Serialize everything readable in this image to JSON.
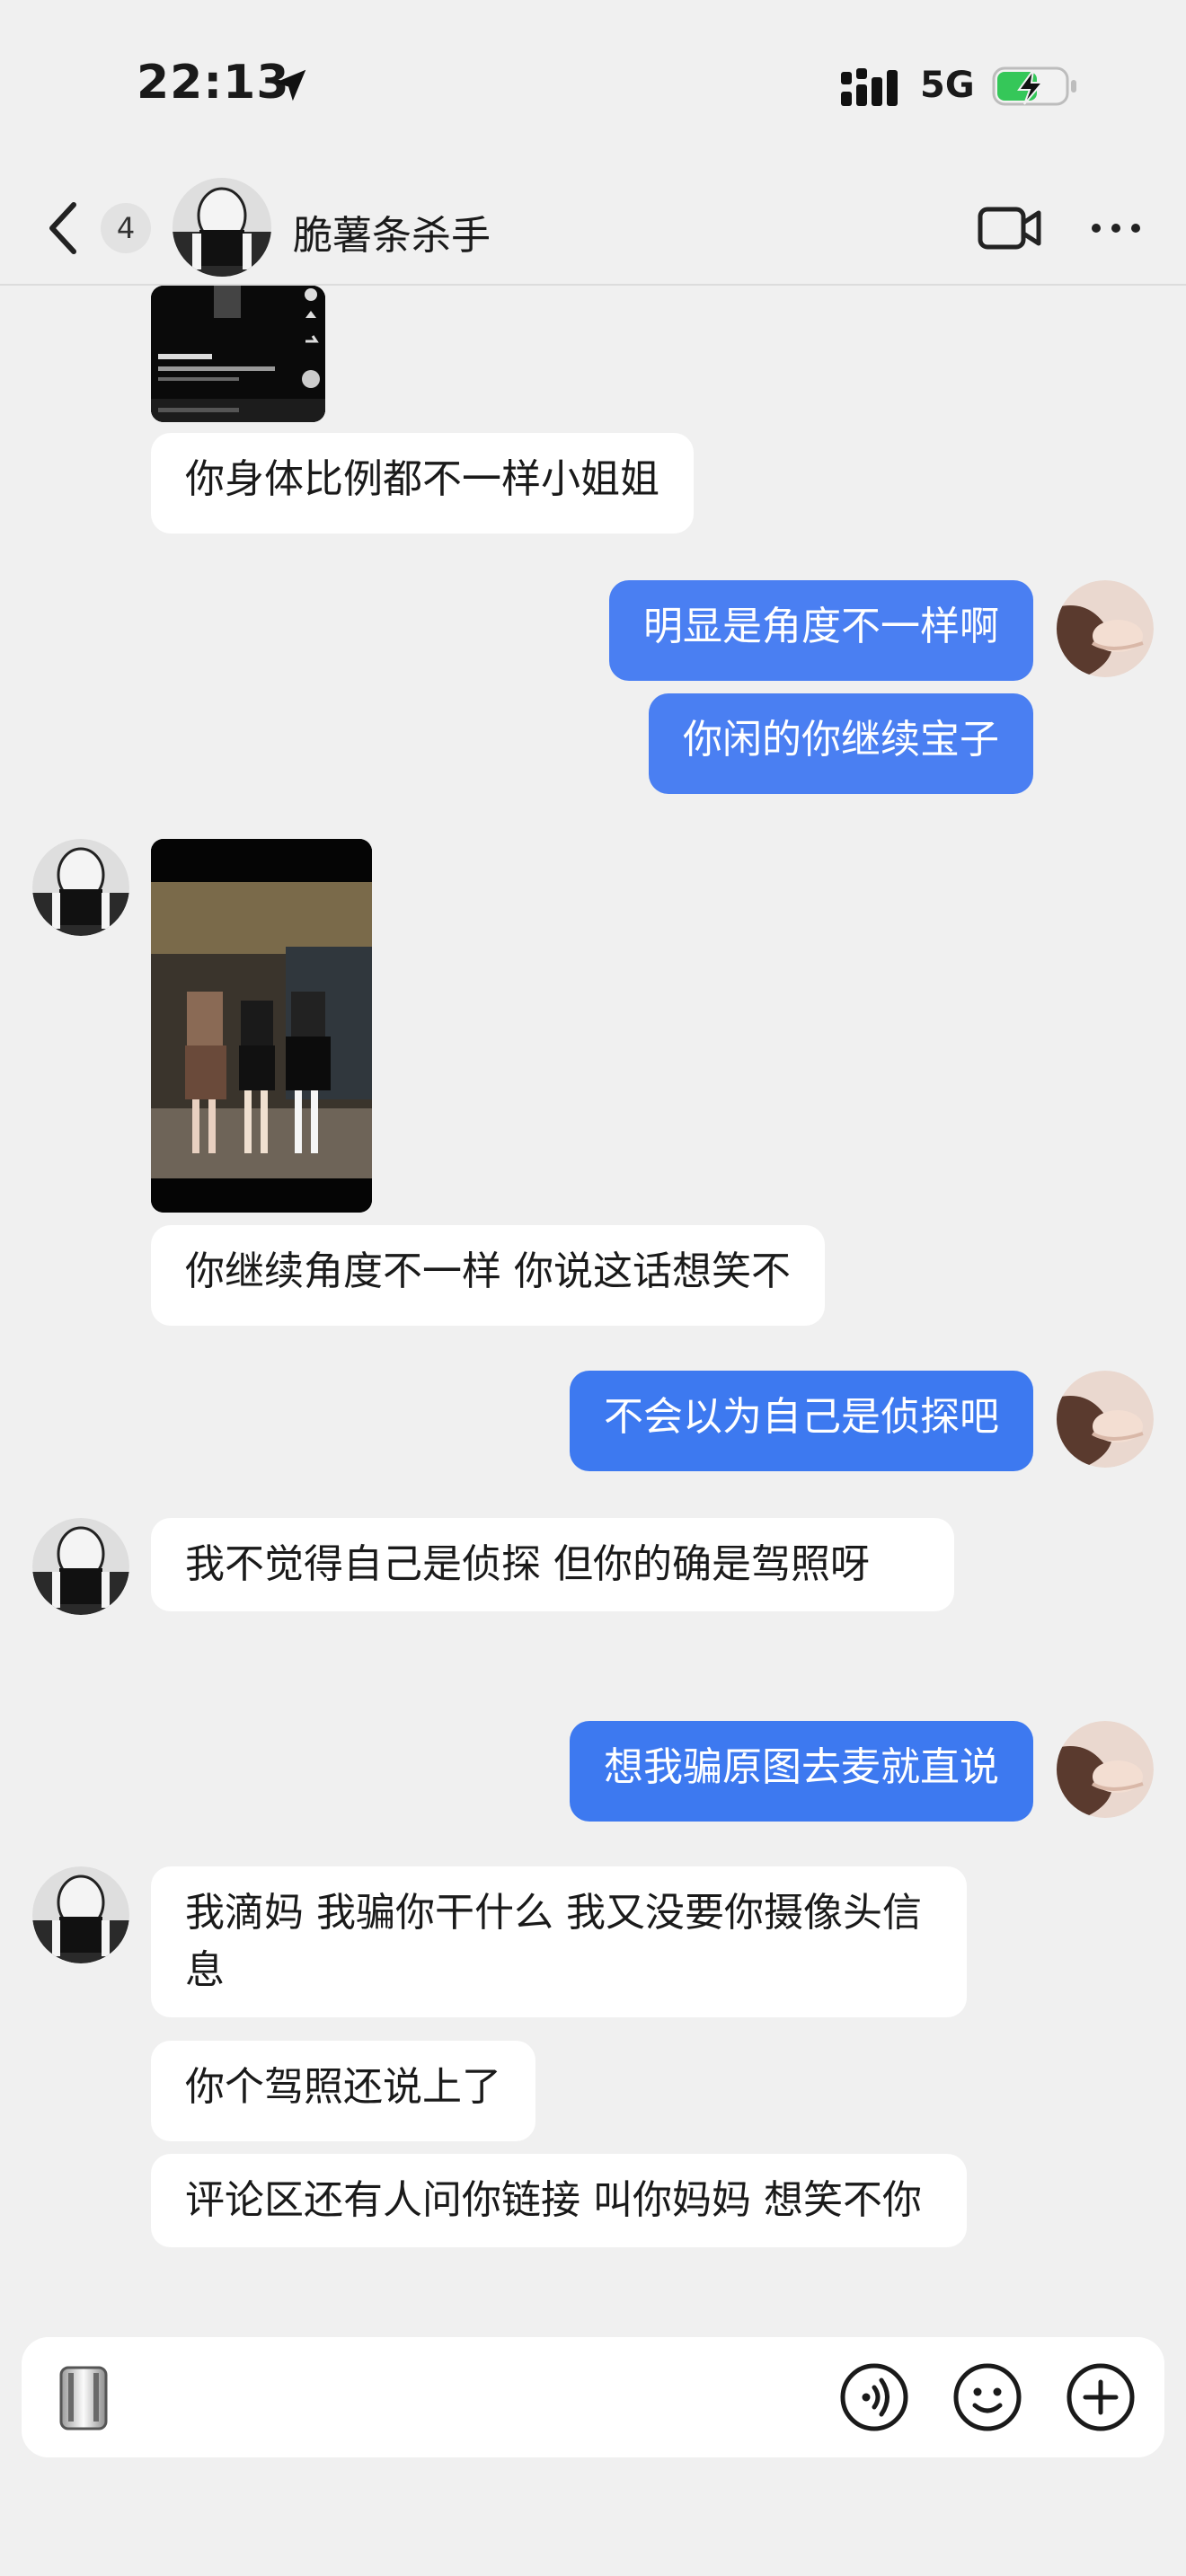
{
  "status_bar": {
    "time": "22:13",
    "network": "5G",
    "icons": [
      "location-arrow-icon",
      "cellular-signal-icon",
      "battery-charging-icon"
    ]
  },
  "header": {
    "unread_count": "4",
    "title": "脆薯条杀手",
    "icons": [
      "back-chevron-icon",
      "video-call-icon",
      "more-icon"
    ]
  },
  "messages": [
    {
      "side": "in",
      "type": "image",
      "desc": "video-thumbnail"
    },
    {
      "side": "in",
      "type": "text",
      "text": "你身体比例都不一样小姐姐"
    },
    {
      "side": "out",
      "type": "text",
      "text": "明显是角度不一样啊"
    },
    {
      "side": "out",
      "type": "text",
      "text": "你闲的你继续宝子"
    },
    {
      "side": "in",
      "type": "image",
      "desc": "photo"
    },
    {
      "side": "in",
      "type": "text",
      "text": "你继续角度不一样 你说这话想笑不"
    },
    {
      "side": "out",
      "type": "text",
      "text": "不会以为自己是侦探吧"
    },
    {
      "side": "in",
      "type": "text",
      "text": "我不觉得自己是侦探 但你的确是驾照呀"
    },
    {
      "side": "out",
      "type": "text",
      "text": "想我骗原图去麦就直说"
    },
    {
      "side": "in",
      "type": "text",
      "text": "我滴妈 我骗你干什么 我又没要你摄像头信息"
    },
    {
      "side": "in",
      "type": "text",
      "text": "你个驾照还说上了"
    },
    {
      "side": "in",
      "type": "text",
      "text": "评论区还有人问你链接 叫你妈妈 想笑不你"
    }
  ],
  "input_bar": {
    "icons": [
      "camera-icon",
      "voice-icon",
      "emoji-icon",
      "plus-icon"
    ]
  },
  "colors": {
    "background": "#f0f0f0",
    "outgoing_bubble": "#3d79f0",
    "incoming_bubble": "#ffffff"
  }
}
